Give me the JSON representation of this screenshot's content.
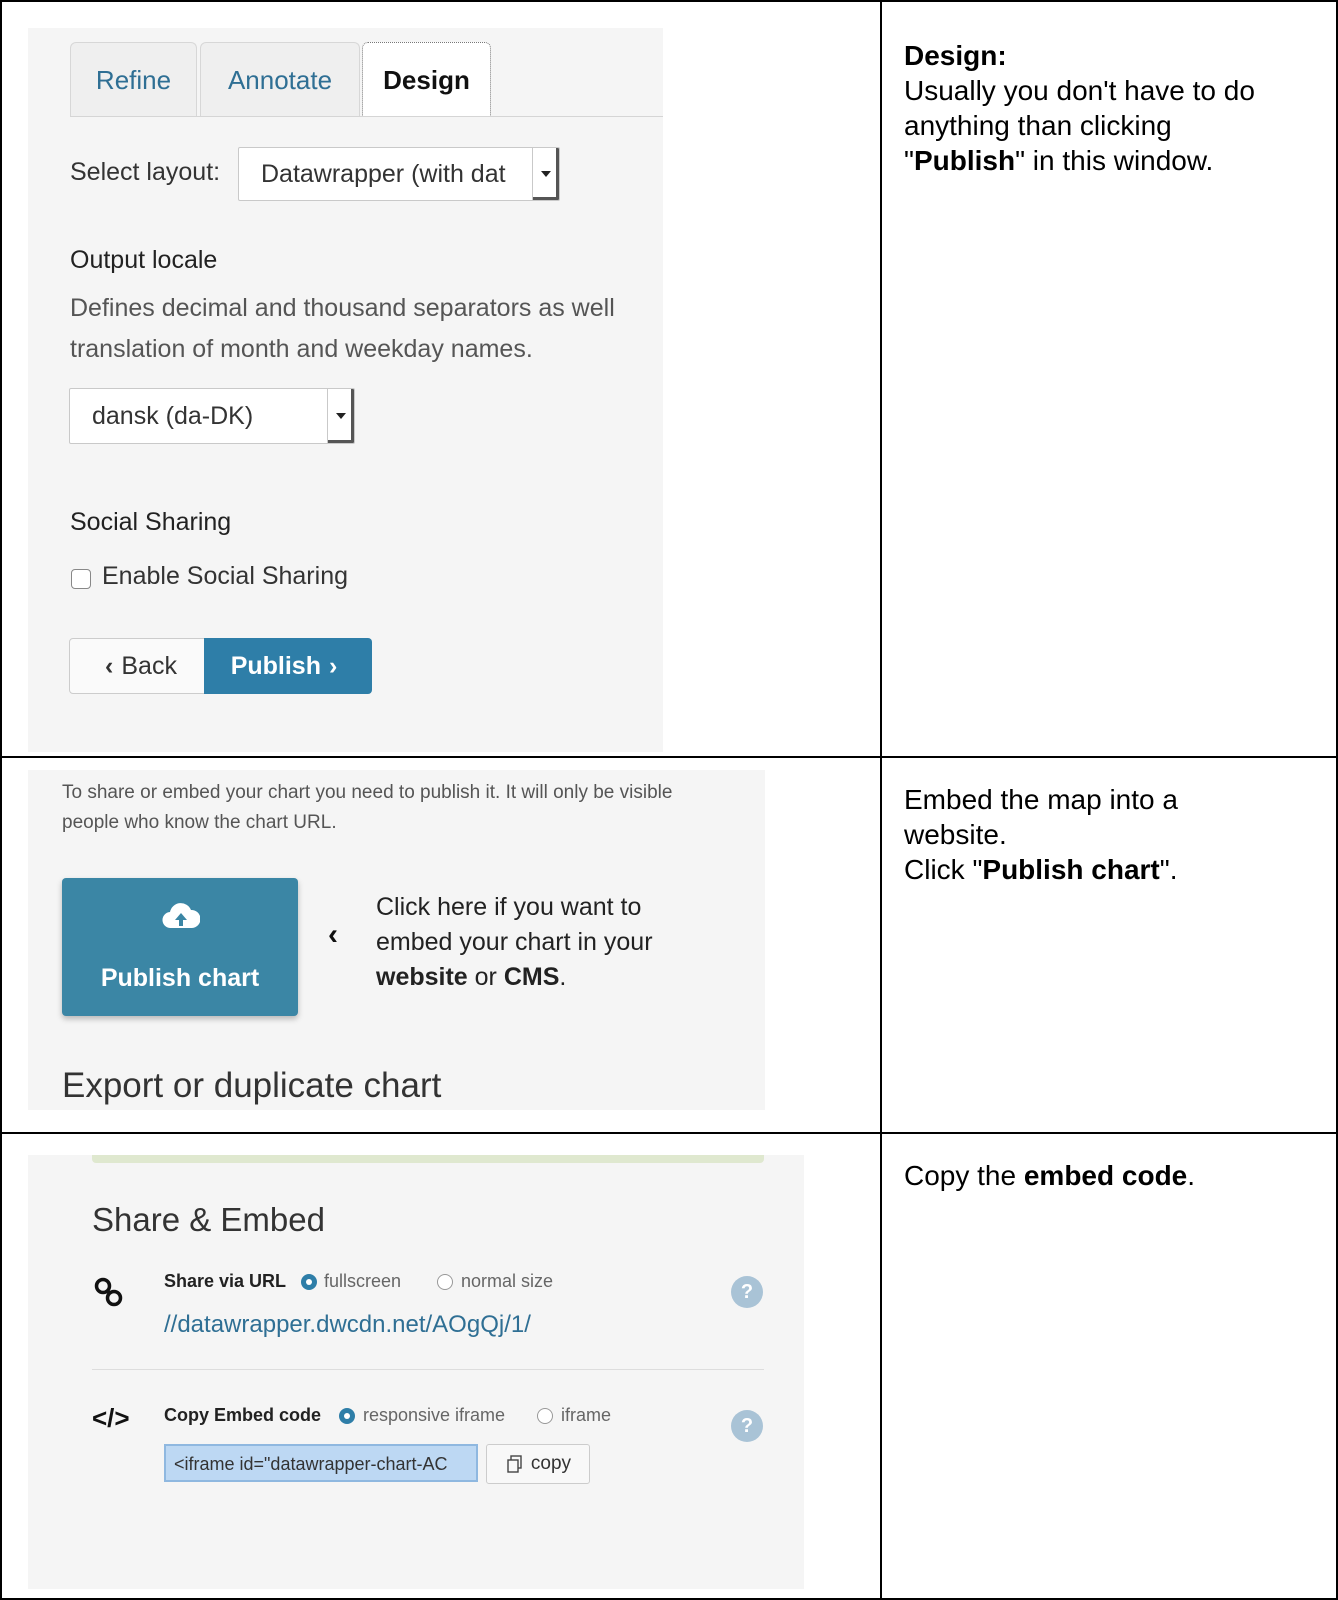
{
  "row1": {
    "note": {
      "heading": "Design:",
      "line1": "Usually you don't have to do",
      "line2": "anything than clicking",
      "quote_open": "\"",
      "bold": "Publish",
      "quote_rest": "\" in this window."
    },
    "tabs": [
      "Refine",
      "Annotate",
      "Design"
    ],
    "layout_label": "Select layout:",
    "layout_value": "Datawrapper (with dat",
    "locale_heading": "Output locale",
    "locale_desc_line1": "Defines decimal and thousand separators as well",
    "locale_desc_line2": "translation of month and weekday names.",
    "locale_value": "dansk (da-DK)",
    "social_heading": "Social Sharing",
    "social_checkbox_label": "Enable Social Sharing",
    "back_label": "Back",
    "publish_label": "Publish"
  },
  "row2": {
    "note": {
      "line1": "Embed the map into a",
      "line2": "website.",
      "click_pre": "Click \"",
      "bold": "Publish chart",
      "click_post": "\"."
    },
    "intro_line1": "To share or embed your chart you need to publish it. It will only be visible",
    "intro_line2": "people who know the chart URL.",
    "publish_chart_label": "Publish chart",
    "hint_line1": "Click here if you want to",
    "hint_line2": "embed your chart in your",
    "hint_bold1": "website",
    "hint_or": " or ",
    "hint_bold2": "CMS",
    "hint_dot": ".",
    "export_heading": "Export or duplicate chart"
  },
  "row3": {
    "note": {
      "pre": "Copy the ",
      "bold": "embed code",
      "post": "."
    },
    "title": "Share & Embed",
    "share_label": "Share via URL",
    "share_opt1": "fullscreen",
    "share_opt2": "normal size",
    "share_url": "//datawrapper.dwcdn.net/AOgQj/1/",
    "embed_label": "Copy Embed code",
    "embed_opt1": "responsive iframe",
    "embed_opt2": "iframe",
    "embed_code": "<iframe id=\"datawrapper-chart-AC",
    "copy_label": "copy",
    "help_glyph": "?",
    "link_icon": "link-icon",
    "code_icon_glyph": "</>"
  }
}
